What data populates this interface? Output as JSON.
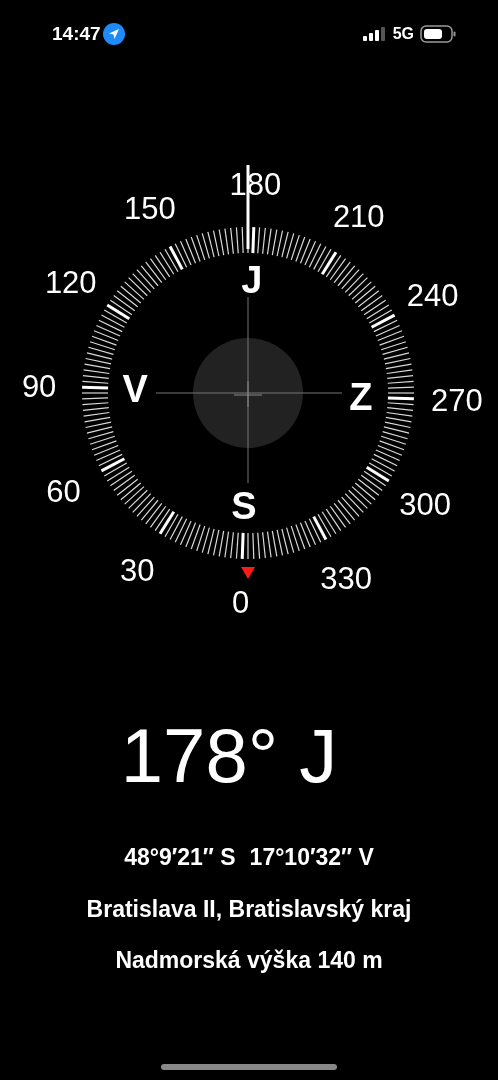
{
  "status_bar": {
    "time": "14:47",
    "network": "5G"
  },
  "compass": {
    "degree_labels": [
      "0",
      "30",
      "60",
      "90",
      "120",
      "150",
      "180",
      "210",
      "240",
      "270",
      "300",
      "330"
    ],
    "cardinals": [
      "S",
      "V",
      "J",
      "Z"
    ]
  },
  "heading": "178° J",
  "latitude": "48°9′21″ S",
  "longitude": "17°10′32″ V",
  "location": "Bratislava II, Bratislavský kraj",
  "elevation": "Nadmorská výška 140 m"
}
